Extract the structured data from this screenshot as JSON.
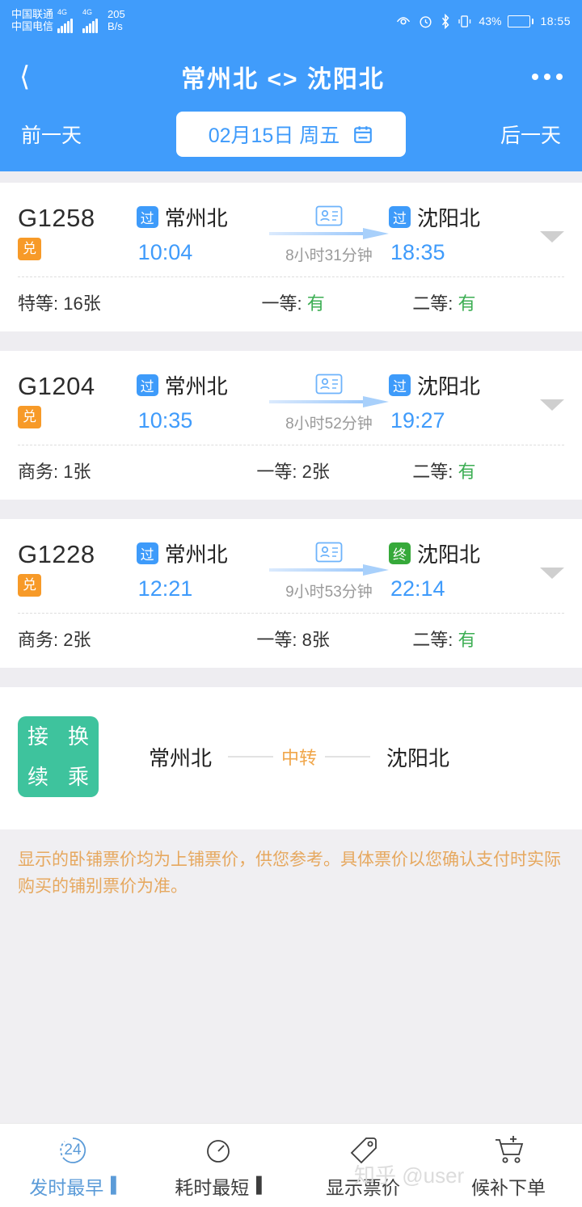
{
  "status_bar": {
    "carrier1": "中国联通",
    "carrier2": "中国电信",
    "net1": "4G",
    "net2": "4G",
    "speed_value": "205",
    "speed_unit": "B/s",
    "battery_percent": "43%",
    "time": "18:55",
    "icons": [
      "eye-icon",
      "alarm-icon",
      "bluetooth-icon",
      "vibrate-icon",
      "battery-icon"
    ]
  },
  "header": {
    "back_icon": "chevron-left-icon",
    "title": "常州北 <> 沈阳北",
    "more_icon": "more-dots-icon",
    "prev_day": "前一天",
    "next_day": "后一天",
    "date_label": "02月15日 周五",
    "calendar_icon": "calendar-icon",
    "accent": "#409cfb"
  },
  "trains": [
    {
      "number": "G1258",
      "exchange_badge": "兑",
      "from_badge": "过",
      "from_badge_type": "pass",
      "from_station": "常州北",
      "depart": "10:04",
      "duration": "8小时31分钟",
      "to_badge": "过",
      "to_badge_type": "pass",
      "to_station": "沈阳北",
      "arrive": "18:35",
      "id_icon": "id-card-icon",
      "expand_icon": "triangle-down-icon",
      "seats": [
        {
          "label": "特等:",
          "value": "16张",
          "kind": "cnt"
        },
        {
          "label": "一等:",
          "value": "有",
          "kind": "has"
        },
        {
          "label": "二等:",
          "value": "有",
          "kind": "has"
        }
      ]
    },
    {
      "number": "G1204",
      "exchange_badge": "兑",
      "from_badge": "过",
      "from_badge_type": "pass",
      "from_station": "常州北",
      "depart": "10:35",
      "duration": "8小时52分钟",
      "to_badge": "过",
      "to_badge_type": "pass",
      "to_station": "沈阳北",
      "arrive": "19:27",
      "id_icon": "id-card-icon",
      "expand_icon": "triangle-down-icon",
      "seats": [
        {
          "label": "商务:",
          "value": "1张",
          "kind": "cnt"
        },
        {
          "label": "一等:",
          "value": "2张",
          "kind": "cnt"
        },
        {
          "label": "二等:",
          "value": "有",
          "kind": "has"
        }
      ]
    },
    {
      "number": "G1228",
      "exchange_badge": "兑",
      "from_badge": "过",
      "from_badge_type": "pass",
      "from_station": "常州北",
      "depart": "12:21",
      "duration": "9小时53分钟",
      "to_badge": "终",
      "to_badge_type": "end",
      "to_station": "沈阳北",
      "arrive": "22:14",
      "id_icon": "id-card-icon",
      "expand_icon": "triangle-down-icon",
      "seats": [
        {
          "label": "商务:",
          "value": "2张",
          "kind": "cnt"
        },
        {
          "label": "一等:",
          "value": "8张",
          "kind": "cnt"
        },
        {
          "label": "二等:",
          "value": "有",
          "kind": "has"
        }
      ]
    }
  ],
  "transfer": {
    "badge_chars": [
      "接",
      "换",
      "续",
      "乘"
    ],
    "from_station": "常州北",
    "mid_label": "中转",
    "to_station": "沈阳北",
    "badge_color": "#3ec39d"
  },
  "notice": "显示的卧铺票价均为上铺票价，供您参考。具体票价以您确认支付时实际购买的铺别票价为准。",
  "bottom_nav": [
    {
      "label": "发时最早",
      "icon": "clock-24-icon",
      "icon_text": "24",
      "marker": "▐",
      "active": true
    },
    {
      "label": "耗时最短",
      "icon": "stopwatch-icon",
      "marker": "▐",
      "active": false
    },
    {
      "label": "显示票价",
      "icon": "price-tag-icon",
      "marker": "",
      "active": false
    },
    {
      "label": "候补下单",
      "icon": "cart-plus-icon",
      "marker": "",
      "active": false
    }
  ],
  "watermark": "知乎 @user"
}
